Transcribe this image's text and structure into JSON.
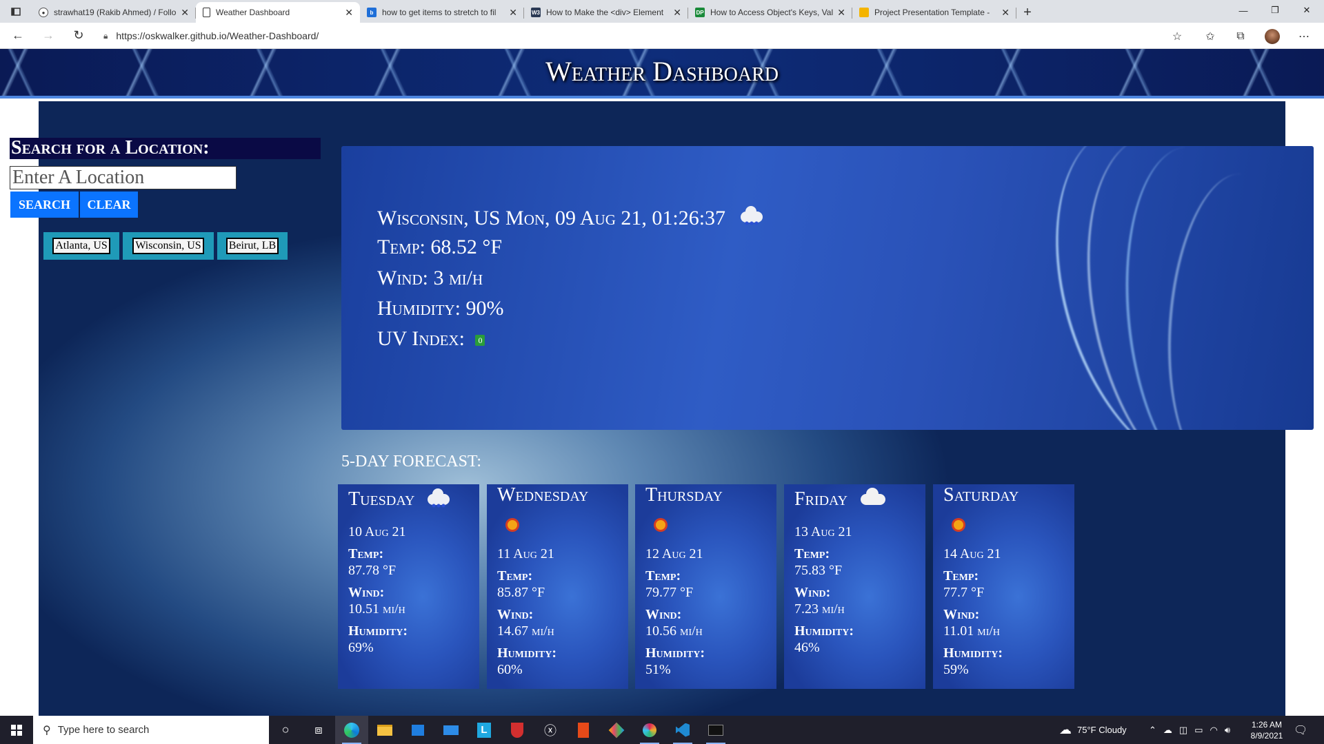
{
  "browser": {
    "tabs": [
      {
        "title": "strawhat19 (Rakib Ahmed) / Follo",
        "active": false,
        "favicon": "github-icon"
      },
      {
        "title": "Weather Dashboard",
        "active": true,
        "favicon": "page-icon"
      },
      {
        "title": "how to get items to stretch to fil",
        "active": false,
        "favicon": "bing-icon"
      },
      {
        "title": "How to Make the <div> Element",
        "active": false,
        "favicon": "w3-icon"
      },
      {
        "title": "How to Access Object's Keys, Val",
        "active": false,
        "favicon": "dp-icon"
      },
      {
        "title": "Project Presentation Template -",
        "active": false,
        "favicon": "slides-icon"
      }
    ],
    "new_tab_symbol": "+",
    "url": "https://oskwalker.github.io/Weather-Dashboard/",
    "favicon_texts": {
      "w3": "W3",
      "dp": "DP"
    }
  },
  "site": {
    "title": "Weather Dashboard"
  },
  "search": {
    "heading": "Search for a Location:",
    "placeholder": "Enter A Location",
    "search_label": "SEARCH",
    "clear_label": "CLEAR",
    "history": [
      "Atlanta, US",
      "Wisconsin, US",
      "Beirut, LB"
    ]
  },
  "current": {
    "location_date": "Wisconsin, US Mon, 09 Aug 21, 01:26:37",
    "icon": "rain-cloud-icon",
    "temp": "Temp: 68.52 °F",
    "wind": "Wind: 3 mi/h",
    "humidity": "Humidity: 90%",
    "uv_label": "UV Index:",
    "uv_value": "0",
    "uv_color": "#2a9d3a"
  },
  "forecast": {
    "heading": "5-DAY FORECAST:",
    "temp_label": "Temp:",
    "wind_label": "Wind:",
    "humidity_label": "Humidity:",
    "days": [
      {
        "day": "Tuesday",
        "icon": "rain-cloud-icon",
        "date": "10 Aug 21",
        "temp": "87.78 °F",
        "wind": "10.51 mi/h",
        "humidity": "69%"
      },
      {
        "day": "Wednesday",
        "icon": "sun-icon",
        "date": "11 Aug 21",
        "temp": "85.87 °F",
        "wind": "14.67 mi/h",
        "humidity": "60%"
      },
      {
        "day": "Thursday",
        "icon": "sun-icon",
        "date": "12 Aug 21",
        "temp": "79.77 °F",
        "wind": "10.56 mi/h",
        "humidity": "51%"
      },
      {
        "day": "Friday",
        "icon": "cloud-icon",
        "date": "13 Aug 21",
        "temp": "75.83 °F",
        "wind": "7.23 mi/h",
        "humidity": "46%"
      },
      {
        "day": "Saturday",
        "icon": "sun-icon",
        "date": "14 Aug 21",
        "temp": "77.7 °F",
        "wind": "11.01 mi/h",
        "humidity": "59%"
      }
    ]
  },
  "taskbar": {
    "search_placeholder": "Type here to search",
    "weather": "75°F  Cloudy",
    "time": "1:26 AM",
    "date": "8/9/2021"
  }
}
